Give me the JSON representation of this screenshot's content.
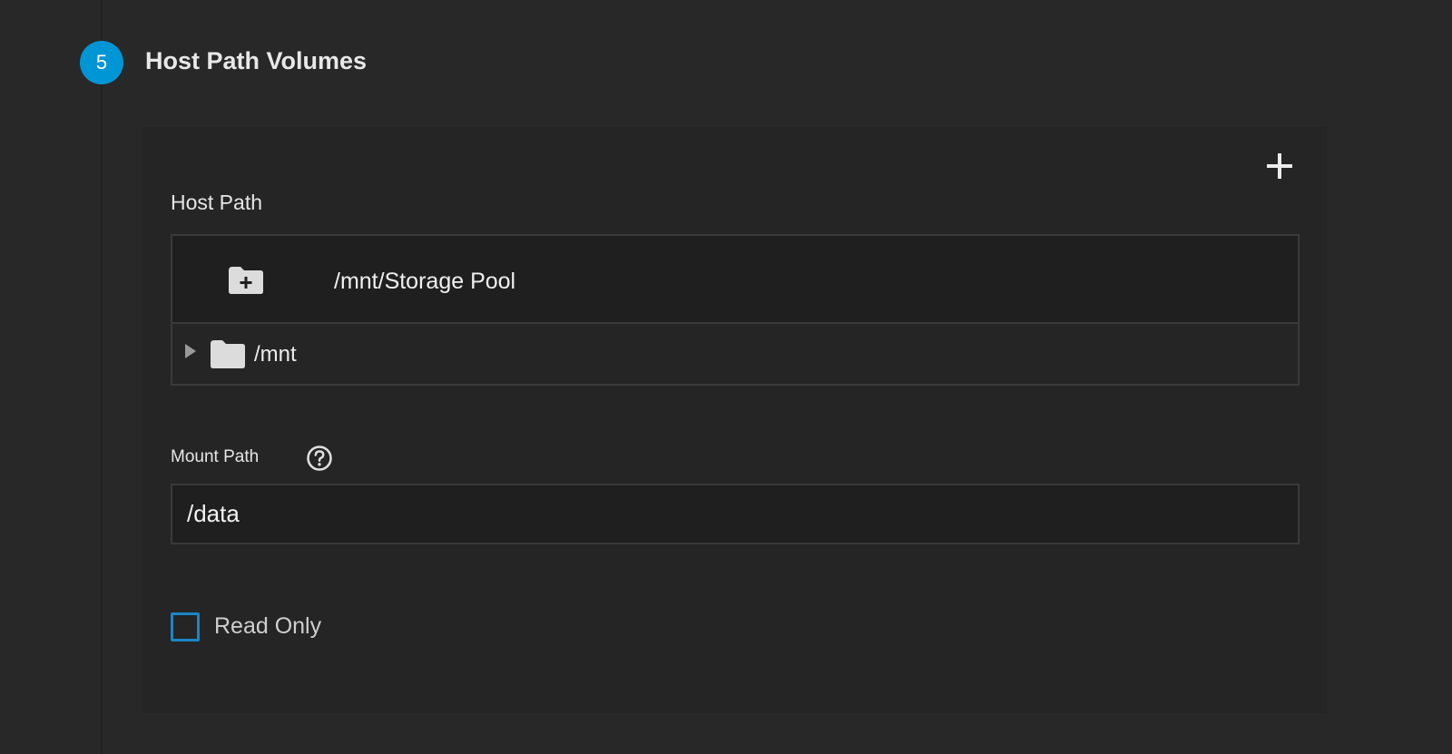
{
  "step": {
    "number": "5",
    "title": "Host Path Volumes"
  },
  "host_path": {
    "label": "Host Path",
    "current_path": "/mnt/Storage Pool",
    "tree": [
      {
        "label": "/mnt",
        "expanded": false
      }
    ]
  },
  "mount_path": {
    "label": "Mount Path",
    "value": "/data"
  },
  "read_only": {
    "label": "Read Only",
    "checked": false
  },
  "icons": {
    "add": "plus-icon",
    "create_folder": "folder-plus-icon",
    "folder": "folder-icon",
    "expand": "triangle-right-icon",
    "help": "help-circle-icon"
  },
  "colors": {
    "accent": "#0095d5",
    "checkbox_border": "#1a86c7",
    "background": "#282828",
    "card": "#252525"
  }
}
